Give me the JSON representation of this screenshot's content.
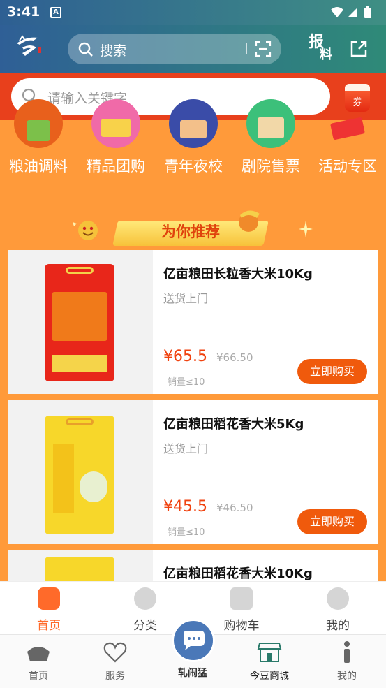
{
  "status_bar": {
    "time": "3:41",
    "notif_letter": "A"
  },
  "header": {
    "search_label": "搜索",
    "report_label_1": "报",
    "report_label_2": "料"
  },
  "search": {
    "placeholder": "请输入关键字",
    "coupon_label": "券"
  },
  "categories": [
    {
      "label": "粮油调料"
    },
    {
      "label": "精品团购"
    },
    {
      "label": "青年夜校"
    },
    {
      "label": "剧院售票"
    },
    {
      "label": "活动专区"
    }
  ],
  "recommend": {
    "title": "为你推荐"
  },
  "products": [
    {
      "title": "亿亩粮田长粒香大米10Kg",
      "delivery": "送货上门",
      "price": "¥65.5",
      "old_price": "¥66.50",
      "sales": "销量≤10",
      "buy": "立即购买"
    },
    {
      "title": "亿亩粮田稻花香大米5Kg",
      "delivery": "送货上门",
      "price": "¥45.5",
      "old_price": "¥46.50",
      "sales": "销量≤10",
      "buy": "立即购买"
    },
    {
      "title": "亿亩粮田稻花香大米10Kg"
    }
  ],
  "bottom_tabs": [
    {
      "label": "首页",
      "active": true
    },
    {
      "label": "分类"
    },
    {
      "label": "购物车"
    },
    {
      "label": "我的"
    }
  ],
  "app_nav": [
    {
      "label": "首页"
    },
    {
      "label": "服务"
    },
    {
      "label": "轧闹猛"
    },
    {
      "label": "今豆商城"
    },
    {
      "label": "我的"
    }
  ],
  "colors": {
    "accent": "#ff6a2a",
    "page_bg": "#ff9a3a",
    "price": "#f0420f",
    "band": "#e8401c"
  }
}
